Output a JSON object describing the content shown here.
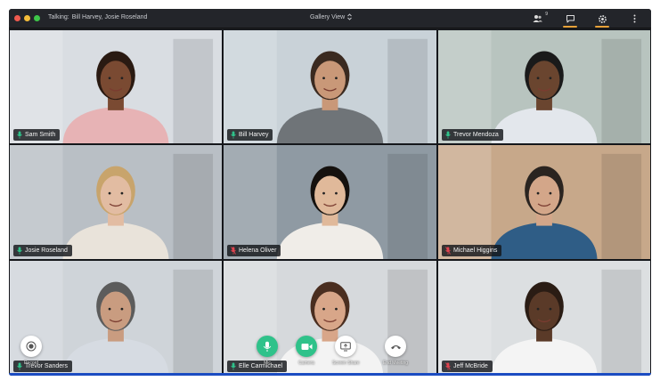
{
  "window": {
    "talking_label": "Talking:",
    "talking_names": "Bill Harvey, Josie Roseland",
    "view_label": "Gallery View"
  },
  "toolbar": {
    "participants_count": "9",
    "icons": [
      "participants-icon",
      "chat-icon",
      "settings-icon",
      "more-icon"
    ],
    "accent": "#e8a23a"
  },
  "participants": [
    {
      "name": "Sam Smith",
      "mic": "on",
      "bg": "#d9dde2",
      "skin": "#7a4a32",
      "hair": "#2a1a12",
      "shirt": "#e7b3b5"
    },
    {
      "name": "Bill Harvey",
      "mic": "on",
      "bg": "#c9d2d8",
      "skin": "#c99878",
      "hair": "#3a2a20",
      "shirt": "#6f7478"
    },
    {
      "name": "Trevor Mendoza",
      "mic": "on",
      "bg": "#b8c4bf",
      "skin": "#6a452f",
      "hair": "#1a1a1a",
      "shirt": "#e3e7ec"
    },
    {
      "name": "Josie Roseland",
      "mic": "on",
      "bg": "#b9bfc5",
      "skin": "#e2bca2",
      "hair": "#c8a46c",
      "shirt": "#e9e3da"
    },
    {
      "name": "Helena Oliver",
      "mic": "off",
      "bg": "#8f9aa3",
      "skin": "#e0b99a",
      "hair": "#15110e",
      "shirt": "#f0ede8"
    },
    {
      "name": "Michael Higgins",
      "mic": "off",
      "bg": "#c7a88a",
      "skin": "#d3a689",
      "hair": "#2a2420",
      "shirt": "#2f5d86"
    },
    {
      "name": "Trevor Sanders",
      "mic": "on",
      "bg": "#cfd4d9",
      "skin": "#c99c80",
      "hair": "#5c5c5c",
      "shirt": "#d6dbe2"
    },
    {
      "name": "Elle Carmichael",
      "mic": "on",
      "bg": "#d6d9dc",
      "skin": "#d8a689",
      "hair": "#4a2e20",
      "shirt": "#f3f3f3"
    },
    {
      "name": "Jeff McBride",
      "mic": "off",
      "bg": "#dcdfe1",
      "skin": "#5a3a28",
      "hair": "#2a1c14",
      "shirt": "#f4f4f4"
    }
  ],
  "controls": {
    "record": "Record",
    "mic": "Mic",
    "camera": "Camera",
    "screen_share": "Screen Share",
    "end_meeting": "End Meeting",
    "mic_color": "#2fc28a",
    "camera_color": "#2fc28a"
  },
  "status_colors": {
    "mic_on": "#2fc28a",
    "mic_off": "#e0434f"
  }
}
